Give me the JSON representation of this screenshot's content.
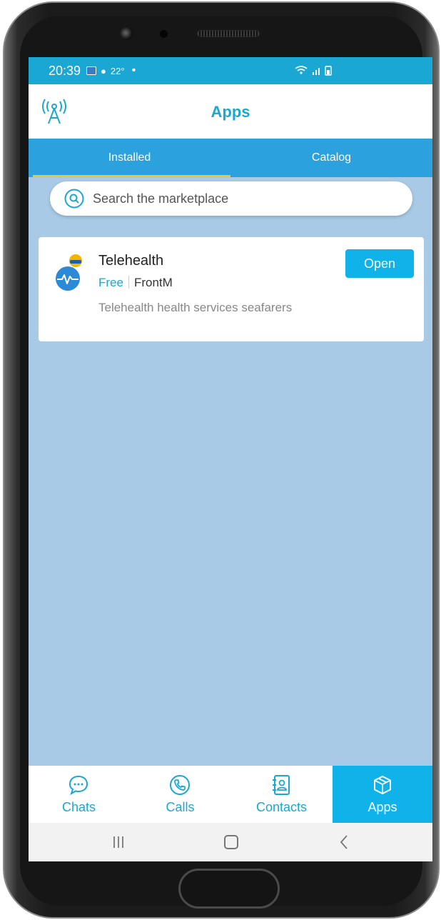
{
  "status_bar": {
    "time": "20:39",
    "temperature": "22°",
    "dot": "•"
  },
  "header": {
    "title": "Apps"
  },
  "tabs": [
    {
      "label": "Installed",
      "selected": true
    },
    {
      "label": "Catalog",
      "selected": false
    }
  ],
  "search": {
    "placeholder": "Search the marketplace"
  },
  "apps": [
    {
      "name": "Telehealth",
      "price": "Free",
      "vendor": "FrontM",
      "description": "Telehealth health services seafarers",
      "action_label": "Open"
    }
  ],
  "bottom_nav": [
    {
      "label": "Chats",
      "icon": "chat-bubble-icon",
      "active": false
    },
    {
      "label": "Calls",
      "icon": "phone-icon",
      "active": false
    },
    {
      "label": "Contacts",
      "icon": "contacts-book-icon",
      "active": false
    },
    {
      "label": "Apps",
      "icon": "package-icon",
      "active": true
    }
  ],
  "colors": {
    "accent": "#1aa7d3",
    "tab_bar": "#2ba1dd",
    "tab_indicator": "#f1c232",
    "content_background": "#a8cae6",
    "button": "#0fb3ea"
  }
}
